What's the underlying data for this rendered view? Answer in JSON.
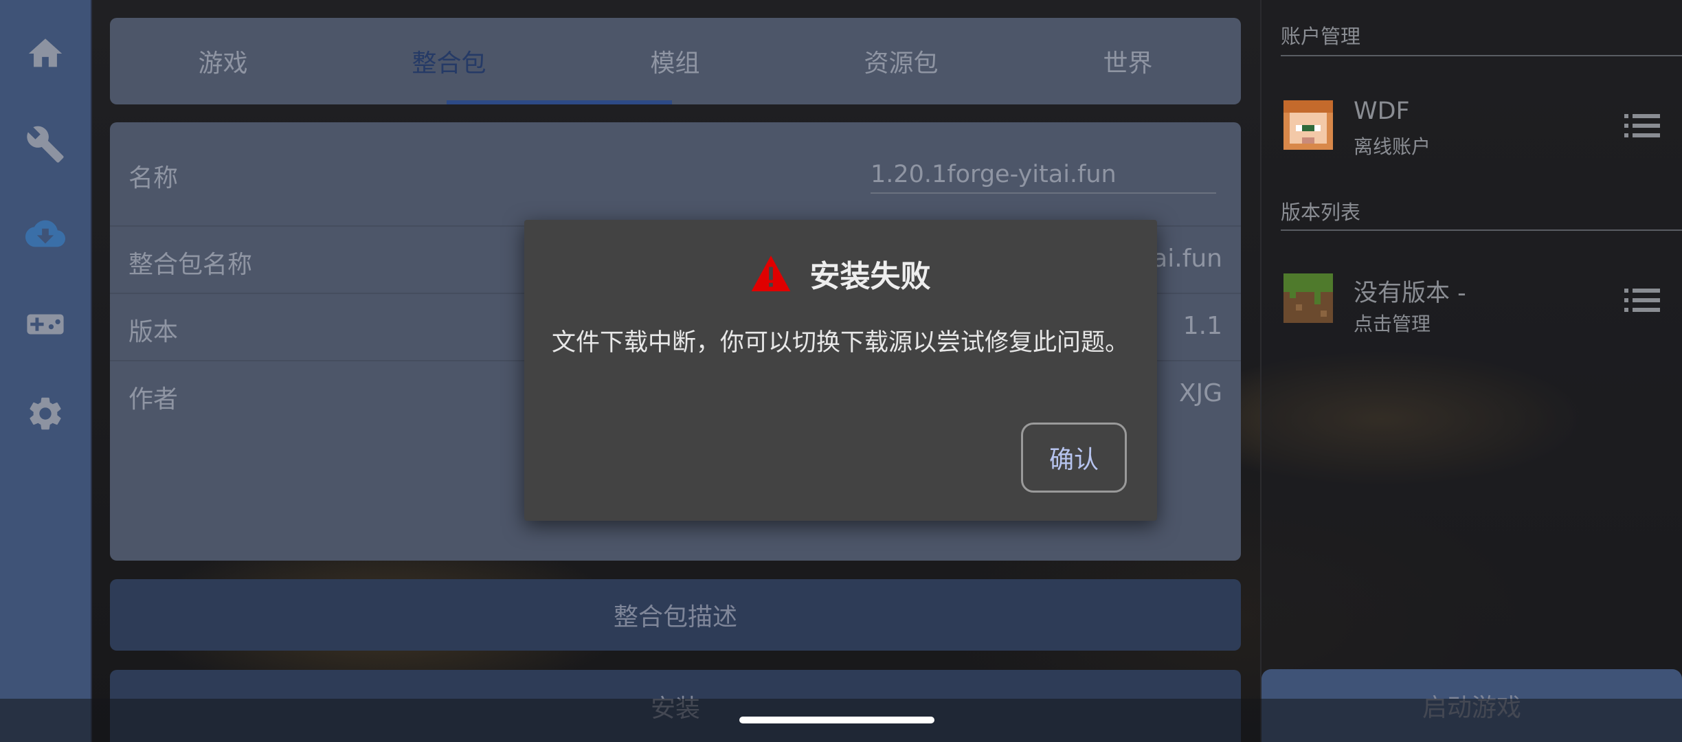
{
  "tabs": [
    {
      "label": "游戏"
    },
    {
      "label": "整合包"
    },
    {
      "label": "模组"
    },
    {
      "label": "资源包"
    },
    {
      "label": "世界"
    }
  ],
  "active_tab": "整合包",
  "info": {
    "name_label": "名称",
    "name_value": "1.20.1forge-yitai.fun",
    "pack_name_label": "整合包名称",
    "pack_name_value": "1.20.1forge-yitai.fun",
    "version_label": "版本",
    "version_value": "1.1",
    "author_label": "作者",
    "author_value": "XJG"
  },
  "buttons": {
    "description": "整合包描述",
    "install": "安装"
  },
  "sidebar": {
    "account_header": "账户管理",
    "account_name": "WDF",
    "account_type": "离线账户",
    "version_header": "版本列表",
    "version_name": "没有版本 -",
    "version_sub": "点击管理",
    "launch": "启动游戏"
  },
  "dialog": {
    "title": "安装失败",
    "message": "文件下载中断，你可以切换下载源以尝试修复此问题。",
    "confirm": "确认"
  },
  "colors": {
    "accent": "#3f5377",
    "warning": "#e00000",
    "confirm_text": "#b7c4ef"
  },
  "icons": [
    "home-icon",
    "wrench-icon",
    "cloud-download-icon",
    "gamepad-icon",
    "gear-icon",
    "warning-icon",
    "list-icon"
  ]
}
